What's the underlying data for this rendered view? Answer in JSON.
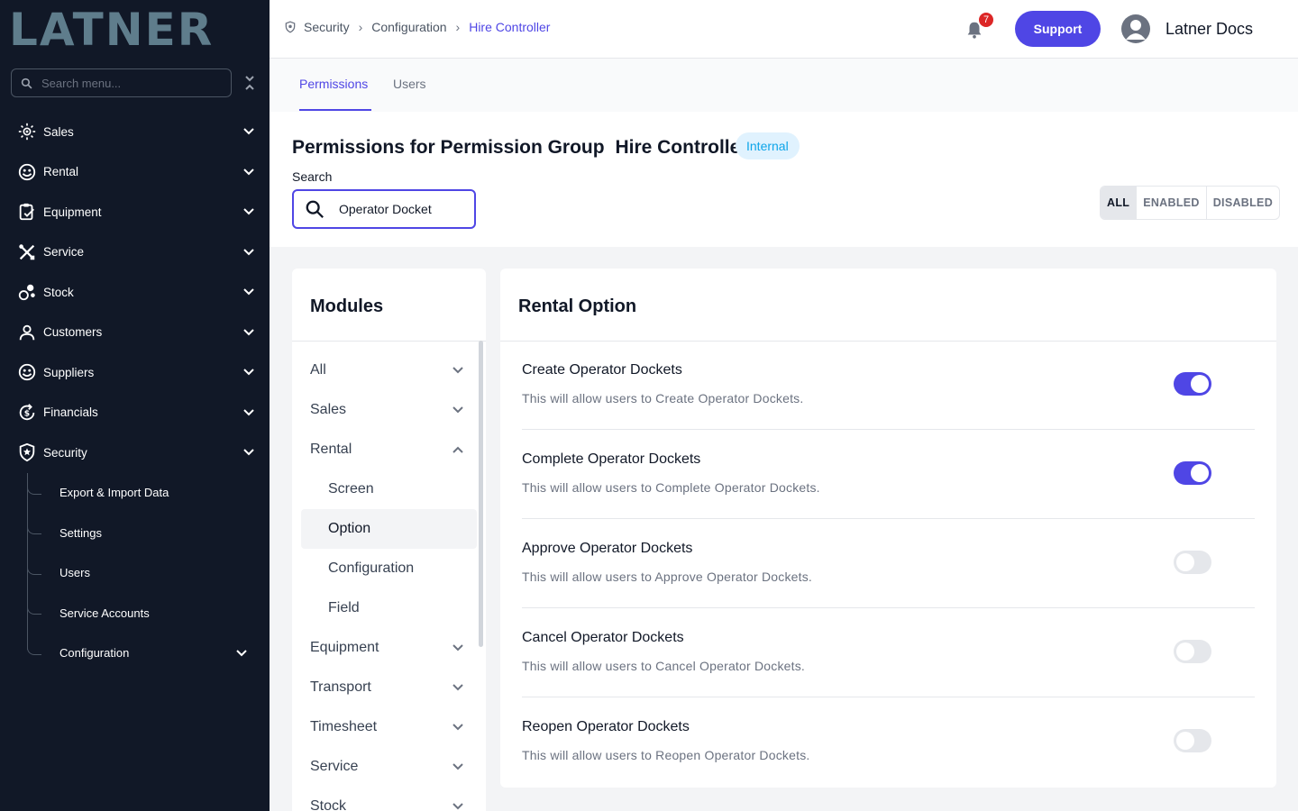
{
  "app": {
    "logo_text": "LATNER"
  },
  "sidebar": {
    "search_placeholder": "Search menu...",
    "items": [
      {
        "label": "Sales",
        "icon": "sales-icon"
      },
      {
        "label": "Rental",
        "icon": "rental-icon"
      },
      {
        "label": "Equipment",
        "icon": "equipment-icon"
      },
      {
        "label": "Service",
        "icon": "service-icon"
      },
      {
        "label": "Stock",
        "icon": "stock-icon"
      },
      {
        "label": "Customers",
        "icon": "customers-icon"
      },
      {
        "label": "Suppliers",
        "icon": "suppliers-icon"
      },
      {
        "label": "Financials",
        "icon": "financials-icon"
      },
      {
        "label": "Security",
        "icon": "security-icon"
      }
    ],
    "security_sub": [
      {
        "label": "Export & Import Data"
      },
      {
        "label": "Settings"
      },
      {
        "label": "Users"
      },
      {
        "label": "Service Accounts"
      },
      {
        "label": "Configuration"
      }
    ]
  },
  "topbar": {
    "breadcrumb": [
      "Security",
      "Configuration",
      "Hire Controller"
    ],
    "notification_count": "7",
    "support_label": "Support",
    "user_name": "Latner Docs"
  },
  "tabs": [
    "Permissions",
    "Users"
  ],
  "header": {
    "title_prefix": "Permissions for Permission Group",
    "group_name": "Hire Controller",
    "badge": "Internal",
    "search_label": "Search",
    "search_value": "Operator Docket",
    "filters": [
      "ALL",
      "ENABLED",
      "DISABLED"
    ],
    "active_filter": "ALL"
  },
  "modules": {
    "title": "Modules",
    "items": [
      "All",
      "Sales",
      "Rental"
    ],
    "rental_sub": [
      "Screen",
      "Option",
      "Configuration",
      "Field"
    ],
    "selected": "Option",
    "more_items": [
      "Equipment",
      "Transport",
      "Timesheet",
      "Service",
      "Stock"
    ]
  },
  "rental_option": {
    "title": "Rental Option",
    "permissions": [
      {
        "title": "Create Operator Dockets",
        "desc": "This will allow users to Create Operator Dockets.",
        "enabled": true
      },
      {
        "title": "Complete Operator Dockets",
        "desc": "This will allow users to Complete Operator Dockets.",
        "enabled": true
      },
      {
        "title": "Approve Operator Dockets",
        "desc": "This will allow users to Approve Operator Dockets.",
        "enabled": false
      },
      {
        "title": "Cancel Operator Dockets",
        "desc": "This will allow users to Cancel Operator Dockets.",
        "enabled": false
      },
      {
        "title": "Reopen Operator Dockets",
        "desc": "This will allow users to Reopen Operator Dockets.",
        "enabled": false
      }
    ]
  },
  "colors": {
    "accent": "#4f46e5",
    "sidebar_bg": "#111827",
    "logo": "#5f7d8c",
    "badge_red": "#dc2626"
  }
}
